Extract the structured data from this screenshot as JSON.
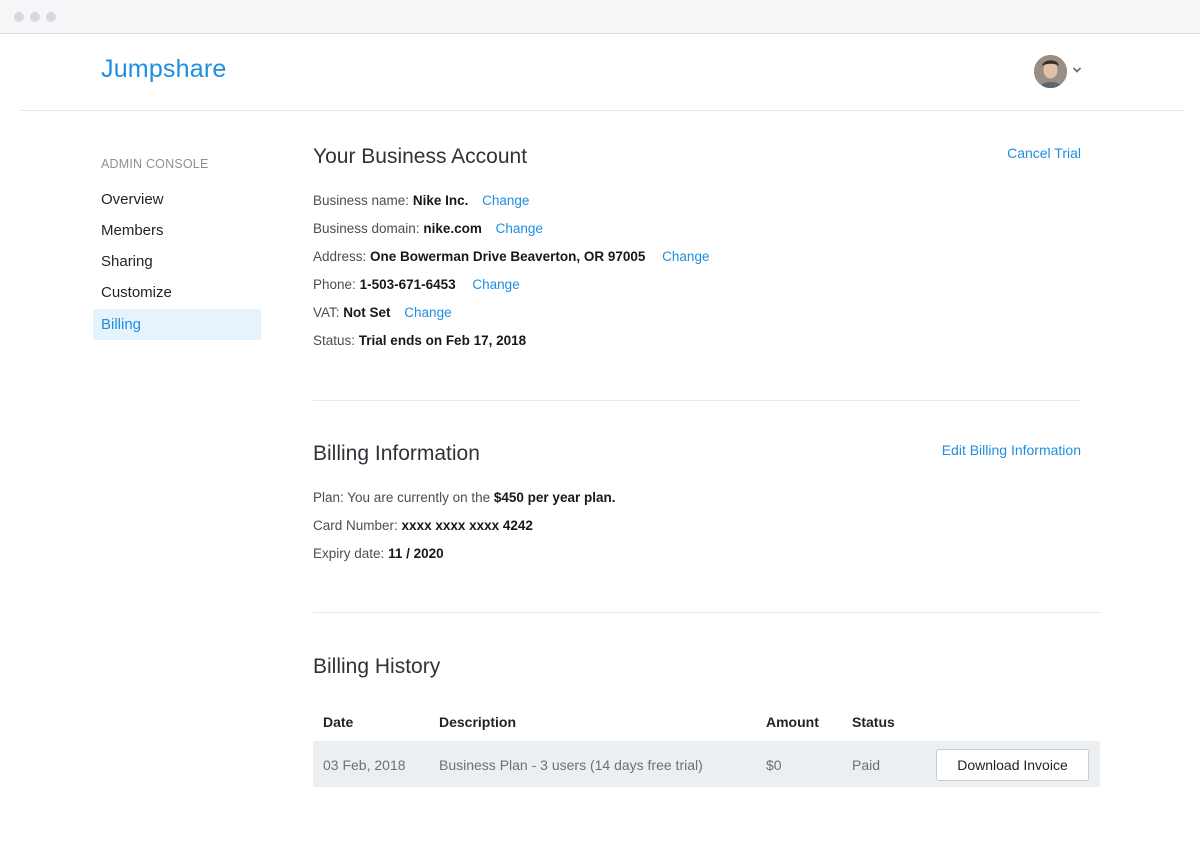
{
  "header": {
    "logo": "Jumpshare"
  },
  "sidebar": {
    "heading": "ADMIN CONSOLE",
    "items": [
      {
        "label": "Overview"
      },
      {
        "label": "Members"
      },
      {
        "label": "Sharing"
      },
      {
        "label": "Customize"
      },
      {
        "label": "Billing",
        "active": true
      }
    ]
  },
  "account": {
    "title": "Your Business Account",
    "cancel_label": "Cancel Trial",
    "business_name_label": "Business name:",
    "business_name": "Nike Inc.",
    "business_domain_label": "Business domain:",
    "business_domain": "nike.com",
    "address_label": "Address:",
    "address": "One Bowerman Drive Beaverton, OR 97005",
    "phone_label": "Phone:",
    "phone": "1-503-671-6453",
    "vat_label": "VAT:",
    "vat": "Not Set",
    "status_label": "Status:",
    "status": "Trial ends on Feb 17, 2018",
    "change_label": "Change"
  },
  "billing": {
    "title": "Billing Information",
    "edit_label": "Edit Billing Information",
    "plan_label": "Plan: You are currently on the",
    "plan": "$450 per year plan.",
    "card_label": "Card Number:",
    "card": "xxxx xxxx xxxx 4242",
    "expiry_label": "Expiry date:",
    "expiry": "11 / 2020"
  },
  "history": {
    "title": "Billing History",
    "columns": [
      "Date",
      "Description",
      "Amount",
      "Status"
    ],
    "rows": [
      {
        "date": "03 Feb, 2018",
        "description": "Business Plan - 3 users (14 days free trial)",
        "amount": "$0",
        "status": "Paid",
        "action": "Download Invoice"
      }
    ]
  },
  "colors": {
    "accent": "#1e8ee0",
    "active_bg": "#e6f3fc",
    "row_bg": "#eceff2"
  }
}
